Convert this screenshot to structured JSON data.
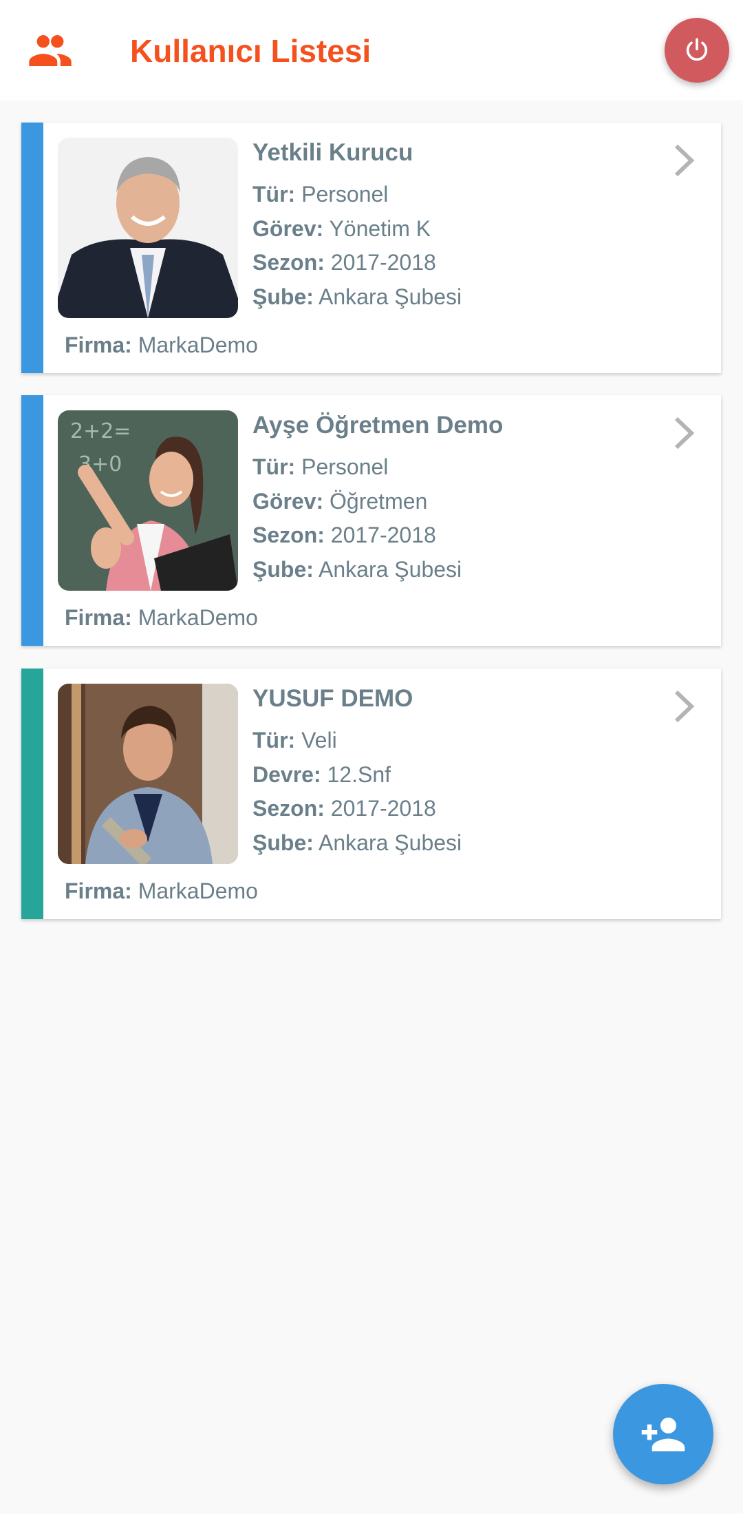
{
  "header": {
    "title": "Kullanıcı Listesi",
    "icon": "people-icon",
    "power_icon": "power-icon",
    "accent_color": "#f4511e",
    "power_color": "#d15a5e"
  },
  "users": [
    {
      "name": "Yetkili Kurucu",
      "stripe_color": "#3b97e0",
      "photo": "photo-man-suit",
      "fields": [
        {
          "label": "Tür:",
          "value": "Personel"
        },
        {
          "label": "Görev:",
          "value": "Yönetim K"
        },
        {
          "label": "Sezon:",
          "value": "2017-2018"
        },
        {
          "label": "Şube:",
          "value": "Ankara Şubesi"
        }
      ],
      "firma_label": "Firma:",
      "firma_value": "MarkaDemo"
    },
    {
      "name": "Ayşe Öğretmen Demo",
      "stripe_color": "#3b97e0",
      "photo": "photo-teacher",
      "fields": [
        {
          "label": "Tür:",
          "value": "Personel"
        },
        {
          "label": "Görev:",
          "value": "Öğretmen"
        },
        {
          "label": "Sezon:",
          "value": "2017-2018"
        },
        {
          "label": "Şube:",
          "value": "Ankara Şubesi"
        }
      ],
      "firma_label": "Firma:",
      "firma_value": "MarkaDemo"
    },
    {
      "name": "YUSUF DEMO",
      "stripe_color": "#26a69a",
      "photo": "photo-student",
      "fields": [
        {
          "label": "Tür:",
          "value": "Veli"
        },
        {
          "label": "Devre:",
          "value": "12.Snf"
        },
        {
          "label": "Sezon:",
          "value": "2017-2018"
        },
        {
          "label": "Şube:",
          "value": "Ankara Şubesi"
        }
      ],
      "firma_label": "Firma:",
      "firma_value": "MarkaDemo"
    }
  ],
  "fab": {
    "icon": "add-user-icon",
    "color": "#3b97e0"
  }
}
